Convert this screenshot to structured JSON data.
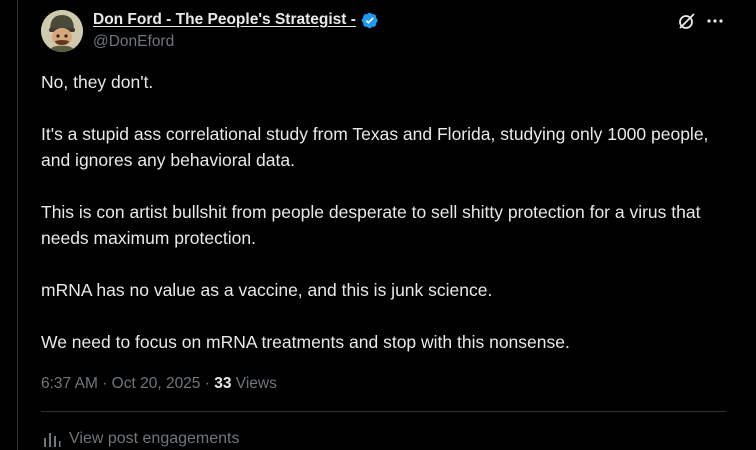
{
  "author": {
    "display_name": "Don Ford - The People's Strategist -",
    "handle": "@DonEford",
    "avatar_icon": "avatar-cartoon-soldier",
    "verified_color": "#1d9bf0"
  },
  "header_icons": [
    "grok-icon",
    "more-icon"
  ],
  "tweet": {
    "paragraphs": [
      "No, they don't.",
      "It's a stupid ass correlational study from Texas and Florida, studying only 1000 people, and ignores any behavioral data.",
      "This is con artist bullshit from people desperate to sell shitty protection for a virus that needs maximum protection.",
      "mRNA has no value as a vaccine, and this is junk science.",
      "We need to focus on mRNA treatments and stop with this nonsense."
    ]
  },
  "meta": {
    "time": "6:37 AM",
    "separator": "·",
    "date": "Oct 20, 2025",
    "views_count": "33",
    "views_label": "Views"
  },
  "actions": {
    "engagements_label": "View post engagements",
    "engagements_icon": "bar-chart-icon"
  },
  "colors": {
    "background": "#000000",
    "text": "#e7e9ea",
    "muted": "#71767b",
    "border": "#2f3336"
  }
}
